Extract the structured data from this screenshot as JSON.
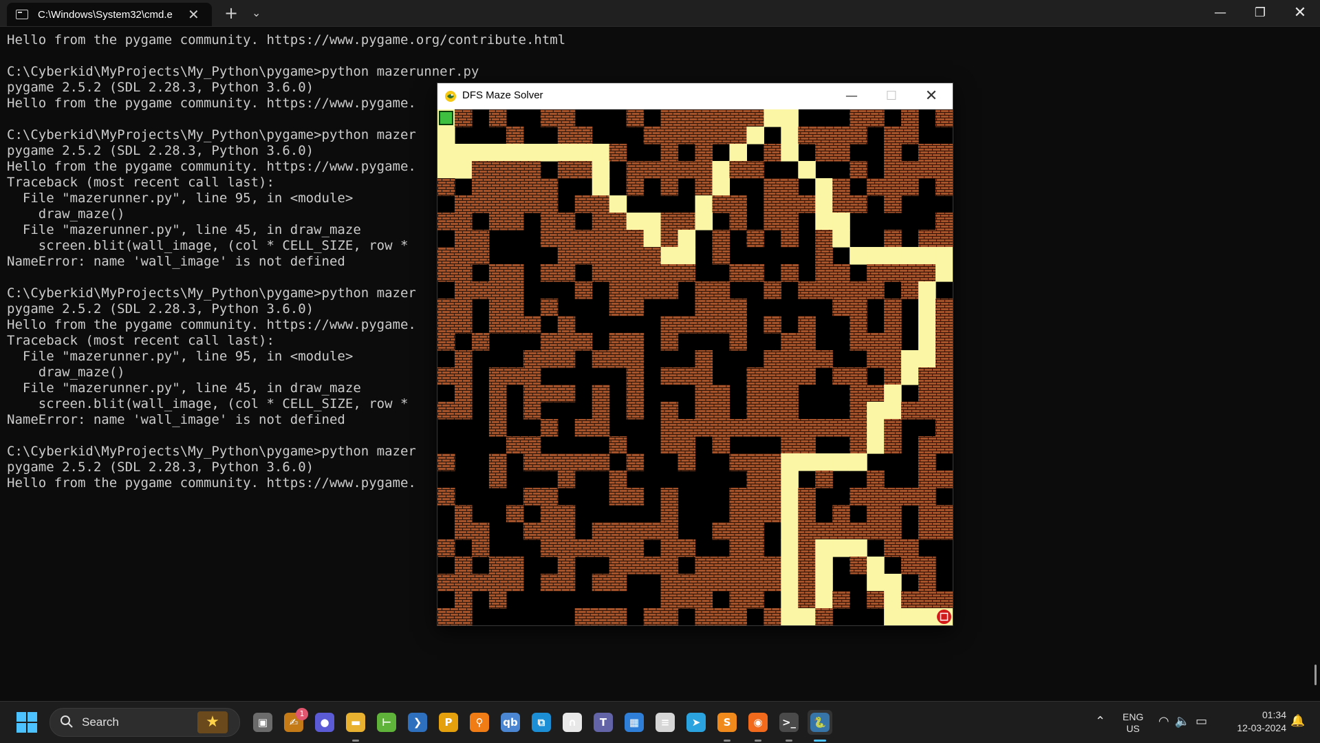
{
  "terminal_window": {
    "tab_title": "C:\\Windows\\System32\\cmd.e",
    "tab_close": "✕",
    "new_tab": "+",
    "dropdown": "⌄",
    "minimize": "—",
    "restore": "❐",
    "close": "✕",
    "output_lines": [
      "Hello from the pygame community. https://www.pygame.org/contribute.html",
      "",
      "C:\\Cyberkid\\MyProjects\\My_Python\\pygame>python mazerunner.py",
      "pygame 2.5.2 (SDL 2.28.3, Python 3.6.0)",
      "Hello from the pygame community. https://www.pygame.",
      "",
      "C:\\Cyberkid\\MyProjects\\My_Python\\pygame>python mazer",
      "pygame 2.5.2 (SDL 2.28.3, Python 3.6.0)",
      "Hello from the pygame community. https://www.pygame.",
      "Traceback (most recent call last):",
      "  File \"mazerunner.py\", line 95, in <module>",
      "    draw_maze()",
      "  File \"mazerunner.py\", line 45, in draw_maze",
      "    screen.blit(wall_image, (col * CELL_SIZE, row *",
      "NameError: name 'wall_image' is not defined",
      "",
      "C:\\Cyberkid\\MyProjects\\My_Python\\pygame>python mazer",
      "pygame 2.5.2 (SDL 2.28.3, Python 3.6.0)",
      "Hello from the pygame community. https://www.pygame.",
      "Traceback (most recent call last):",
      "  File \"mazerunner.py\", line 95, in <module>",
      "    draw_maze()",
      "  File \"mazerunner.py\", line 45, in draw_maze",
      "    screen.blit(wall_image, (col * CELL_SIZE, row *",
      "NameError: name 'wall_image' is not defined",
      "",
      "C:\\Cyberkid\\MyProjects\\My_Python\\pygame>python mazer",
      "pygame 2.5.2 (SDL 2.28.3, Python 3.6.0)",
      "Hello from the pygame community. https://www.pygame."
    ]
  },
  "pygame_window": {
    "title": "DFS Maze Solver",
    "minimize": "—",
    "maximize": "☐",
    "close": "✕",
    "maze": {
      "rows": 30,
      "cols": 30,
      "colors": {
        "wall": "#a5532b",
        "mortar": "#2a1206",
        "path": "#000000",
        "solution": "#fbf6a5",
        "start": "#3fbf3f",
        "end": "#d11a1a"
      },
      "start_cell": [
        0,
        0
      ],
      "end_cell": [
        29,
        29
      ],
      "solution_path": [
        [
          0,
          0
        ],
        [
          1,
          0
        ],
        [
          2,
          0
        ],
        [
          3,
          0
        ],
        [
          3,
          1
        ],
        [
          2,
          1
        ],
        [
          2,
          2
        ],
        [
          2,
          3
        ],
        [
          2,
          4
        ],
        [
          2,
          5
        ],
        [
          2,
          6
        ],
        [
          2,
          7
        ],
        [
          2,
          8
        ],
        [
          2,
          9
        ],
        [
          3,
          9
        ],
        [
          4,
          9
        ],
        [
          5,
          10
        ],
        [
          6,
          11
        ],
        [
          6,
          12
        ],
        [
          7,
          12
        ],
        [
          8,
          13
        ],
        [
          8,
          14
        ],
        [
          7,
          14
        ],
        [
          6,
          15
        ],
        [
          5,
          15
        ],
        [
          4,
          16
        ],
        [
          3,
          16
        ],
        [
          2,
          17
        ],
        [
          1,
          18
        ],
        [
          0,
          19
        ],
        [
          0,
          20
        ],
        [
          1,
          20
        ],
        [
          2,
          20
        ],
        [
          3,
          21
        ],
        [
          4,
          22
        ],
        [
          5,
          22
        ],
        [
          6,
          22
        ],
        [
          6,
          23
        ],
        [
          7,
          23
        ],
        [
          8,
          24
        ],
        [
          8,
          25
        ],
        [
          8,
          26
        ],
        [
          8,
          27
        ],
        [
          8,
          28
        ],
        [
          8,
          29
        ],
        [
          9,
          29
        ],
        [
          10,
          28
        ],
        [
          11,
          28
        ],
        [
          12,
          28
        ],
        [
          13,
          28
        ],
        [
          14,
          28
        ],
        [
          14,
          27
        ],
        [
          15,
          27
        ],
        [
          16,
          26
        ],
        [
          17,
          26
        ],
        [
          17,
          25
        ],
        [
          18,
          25
        ],
        [
          19,
          25
        ],
        [
          20,
          24
        ],
        [
          20,
          23
        ],
        [
          20,
          22
        ],
        [
          20,
          21
        ],
        [
          20,
          20
        ],
        [
          21,
          20
        ],
        [
          22,
          20
        ],
        [
          23,
          20
        ],
        [
          24,
          20
        ],
        [
          25,
          20
        ],
        [
          26,
          20
        ],
        [
          27,
          20
        ],
        [
          28,
          20
        ],
        [
          29,
          20
        ],
        [
          29,
          21
        ],
        [
          28,
          22
        ],
        [
          27,
          22
        ],
        [
          26,
          22
        ],
        [
          25,
          22
        ],
        [
          25,
          23
        ],
        [
          25,
          24
        ],
        [
          26,
          25
        ],
        [
          27,
          25
        ],
        [
          27,
          26
        ],
        [
          28,
          26
        ],
        [
          29,
          26
        ],
        [
          29,
          27
        ],
        [
          29,
          28
        ],
        [
          29,
          29
        ]
      ]
    }
  },
  "taskbar": {
    "search_label": "Search",
    "notification_badge": "1",
    "apps": [
      {
        "name": "Task View",
        "glyph": "▣",
        "color": "#6b6b6b",
        "running": false
      },
      {
        "name": "Ink",
        "glyph": "✍",
        "color": "#c47a16",
        "running": false
      },
      {
        "name": "Chat",
        "glyph": "●",
        "color": "#5b5bd6",
        "running": false
      },
      {
        "name": "File Explorer",
        "glyph": "▬",
        "color": "#e9b130",
        "running": true
      },
      {
        "name": "Notepad++",
        "glyph": "⊢",
        "color": "#60b33a",
        "running": false
      },
      {
        "name": "PowerShell",
        "glyph": "❯",
        "color": "#2e6fbe",
        "running": false
      },
      {
        "name": "Plex",
        "glyph": "P",
        "color": "#e5a00d",
        "running": false
      },
      {
        "name": "Search Everything",
        "glyph": "⚲",
        "color": "#f07c16",
        "running": false
      },
      {
        "name": "qBittorrent",
        "glyph": "qb",
        "color": "#4a86d1",
        "running": false
      },
      {
        "name": "Snip",
        "glyph": "⧉",
        "color": "#1b8ed6",
        "running": false
      },
      {
        "name": "Headphones",
        "glyph": "∩",
        "color": "#e8e8e8",
        "running": false
      },
      {
        "name": "Teams",
        "glyph": "T",
        "color": "#6264a7",
        "running": false
      },
      {
        "name": "Store",
        "glyph": "▦",
        "color": "#2f7fd8",
        "running": false
      },
      {
        "name": "Notes",
        "glyph": "≡",
        "color": "#d6d6d6",
        "running": false
      },
      {
        "name": "Telegram",
        "glyph": "➤",
        "color": "#2aa3df",
        "running": false
      },
      {
        "name": "Sublime Text",
        "glyph": "S",
        "color": "#f08a1c",
        "running": true
      },
      {
        "name": "Firefox",
        "glyph": "◉",
        "color": "#f26b1d",
        "running": true
      },
      {
        "name": "Terminal",
        "glyph": ">_",
        "color": "#4a4a4a",
        "running": true
      },
      {
        "name": "Python",
        "glyph": "🐍",
        "color": "#3774a7",
        "running": true,
        "active": true
      }
    ],
    "lang_line1": "ENG",
    "lang_line2": "US",
    "time": "01:34",
    "date": "12-03-2024"
  }
}
